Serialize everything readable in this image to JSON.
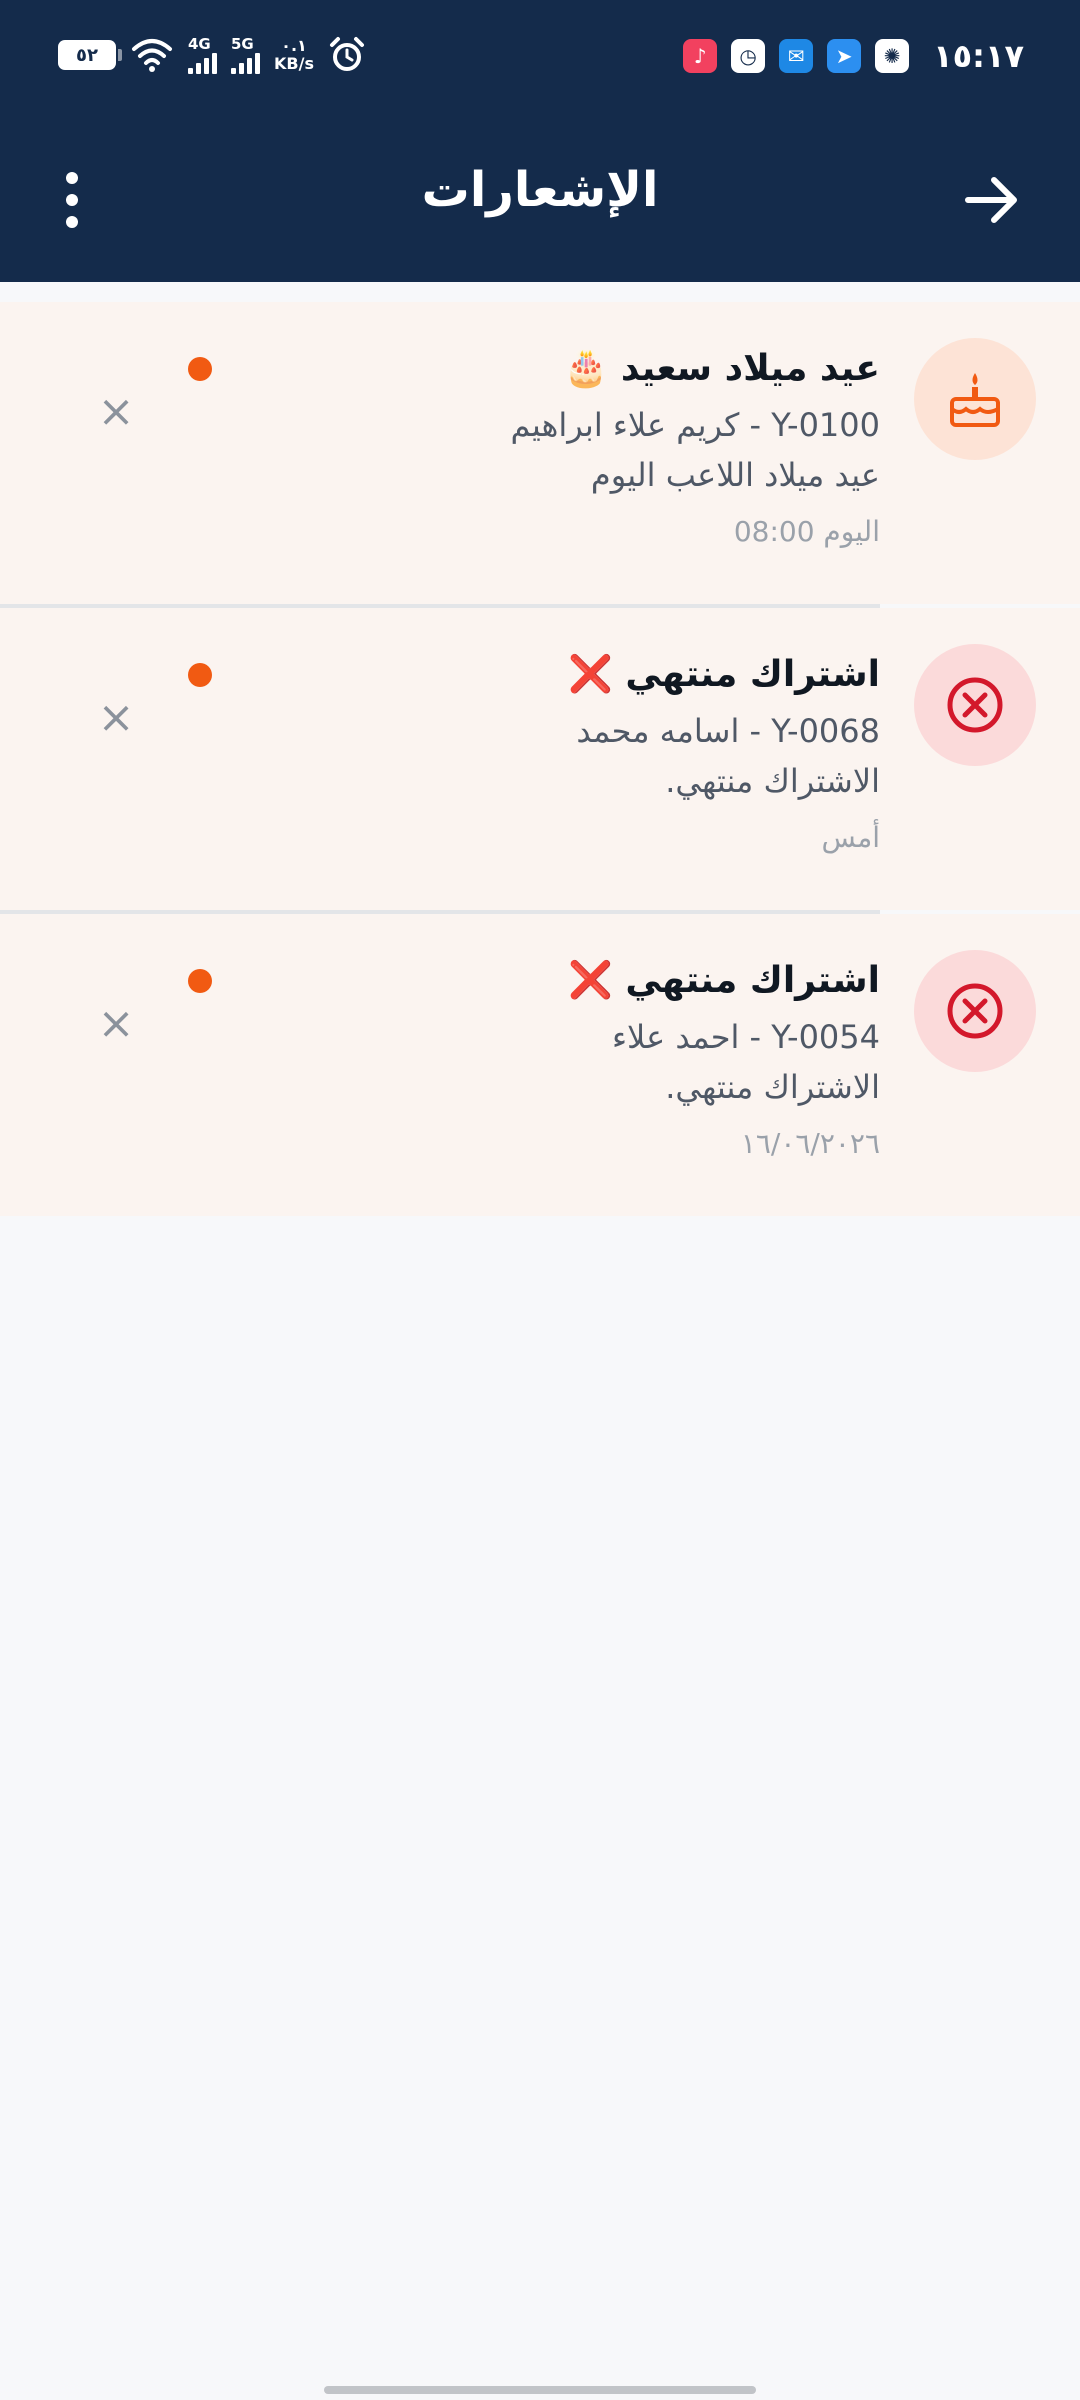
{
  "status_bar": {
    "battery": "٥٢",
    "net1_label": "4G",
    "net2_label": "5G",
    "speed_value": "٠.١",
    "speed_unit": "KB/s",
    "time": "١٥:١٧"
  },
  "header": {
    "title": "الإشعارات"
  },
  "notifications": [
    {
      "title": "عيد ميلاد سعيد 🎂",
      "line1": "Y-0100 - كريم علاء ابراهيم",
      "line2": "عيد ميلاد اللاعب اليوم",
      "time": "اليوم 08:00",
      "icon": "cake-icon",
      "icon_bg": "#fde3d6",
      "icon_color": "#f15a12"
    },
    {
      "title": "اشتراك منتهي ❌",
      "line1": "Y-0068 - اسامه محمد",
      "line2": "الاشتراك منتهي.",
      "time": "أمس",
      "icon": "cancel-circle-icon",
      "icon_bg": "#fbdada",
      "icon_color": "#d3182b"
    },
    {
      "title": "اشتراك منتهي ❌",
      "line1": "Y-0054 - احمد علاء",
      "line2": "الاشتراك منتهي.",
      "time": "١٦/٠٦/٢٠٢٦",
      "icon": "cancel-circle-icon",
      "icon_bg": "#fbdada",
      "icon_color": "#d3182b"
    }
  ],
  "colors": {
    "header_bg": "#142b4b",
    "unread_dot": "#f15a12",
    "card_bg": "#fbf4f0",
    "page_bg": "#f7f8fa"
  }
}
